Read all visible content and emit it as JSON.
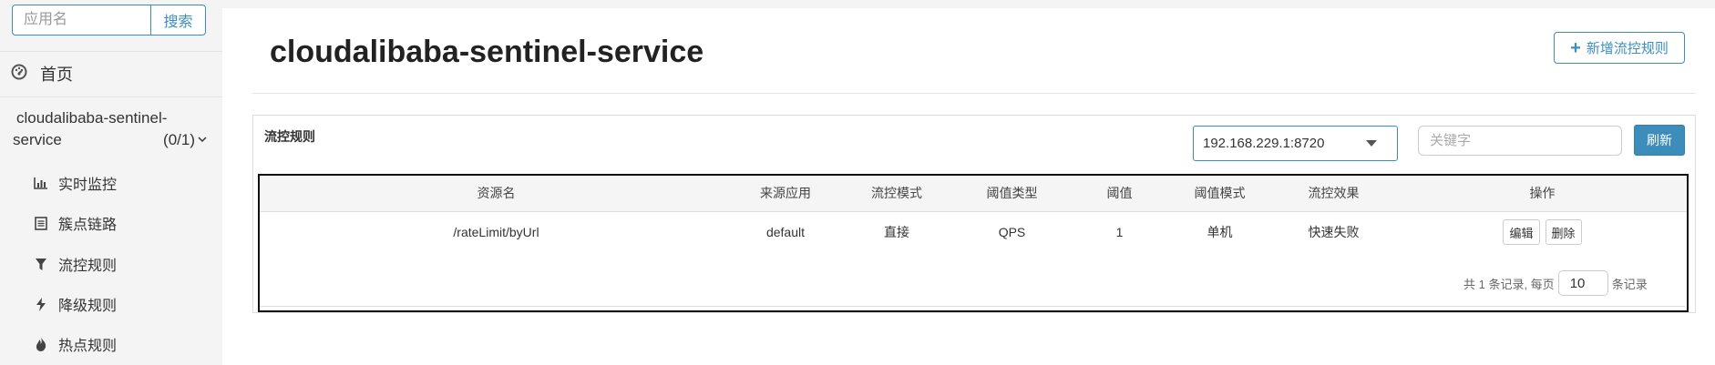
{
  "sidebar": {
    "search": {
      "placeholder": "应用名",
      "button_label": "搜索"
    },
    "home_label": "首页",
    "app": {
      "name_line1": "cloudalibaba-sentinel-",
      "name_line2": "service",
      "count": "(0/1)"
    },
    "items": [
      {
        "label": "实时监控",
        "icon": "bar-chart-icon"
      },
      {
        "label": "簇点链路",
        "icon": "list-icon"
      },
      {
        "label": "流控规则",
        "icon": "filter-icon"
      },
      {
        "label": "降级规则",
        "icon": "bolt-icon"
      },
      {
        "label": "热点规则",
        "icon": "fire-icon"
      }
    ]
  },
  "header": {
    "title": "cloudalibaba-sentinel-service",
    "add_rule_label": "新增流控规则"
  },
  "panel": {
    "title": "流控规则",
    "machine_select": "192.168.229.1:8720",
    "keyword_placeholder": "关键字",
    "refresh_label": "刷新"
  },
  "table": {
    "headers": [
      "资源名",
      "来源应用",
      "流控模式",
      "阈值类型",
      "阈值",
      "阈值模式",
      "流控效果",
      "操作"
    ],
    "rows": [
      {
        "resource": "/rateLimit/byUrl",
        "origin": "default",
        "mode": "直接",
        "grade": "QPS",
        "count": "1",
        "cluster": "单机",
        "effect": "快速失败",
        "edit_label": "编辑",
        "delete_label": "删除"
      }
    ]
  },
  "pagination": {
    "prefix": "共 1 条记录, 每页",
    "page_size": "10",
    "suffix": "条记录"
  },
  "colors": {
    "accent": "#3c8dbc",
    "sidebar_bg": "#f4f4f5"
  }
}
